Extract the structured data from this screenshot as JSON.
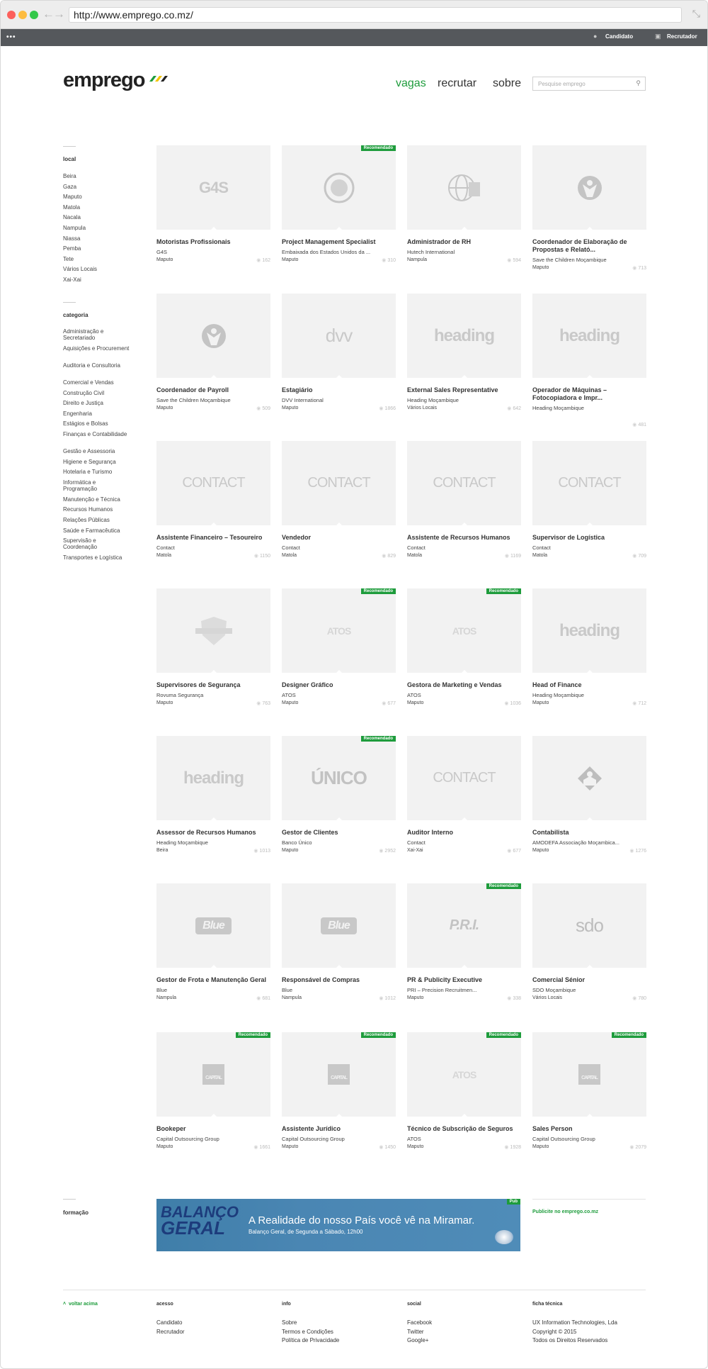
{
  "browser": {
    "url": "http://www.emprego.co.mz/"
  },
  "topbar": {
    "menu_label": "•••",
    "candidato": "Candidato",
    "recrutador": "Recrutador"
  },
  "header": {
    "logo": "emprego",
    "nav": [
      {
        "label": "vagas",
        "active": true
      },
      {
        "label": "recrutar",
        "active": false
      },
      {
        "label": "sobre",
        "active": false
      }
    ],
    "search_placeholder": "Pesquise emprego"
  },
  "sidebar": {
    "local_title": "local",
    "locations": [
      "Beira",
      "Gaza",
      "Maputo",
      "Matola",
      "Nacala",
      "Nampula",
      "Niassa",
      "Pemba",
      "Tete",
      "Vários Locais",
      "Xai-Xai"
    ],
    "category_title": "categoria",
    "categories": [
      "Administração e Secretariado",
      "Aquisições e Procurement",
      "Auditoria e Consultoria",
      "Comercial e Vendas",
      "Construção Civil",
      "Direito e Justiça",
      "Engenharia",
      "Estágios e Bolsas",
      "Finanças e Contabilidade",
      "Gestão e Assessoria",
      "Higiene e Segurança",
      "Hotelaria e Turismo",
      "Informática e Programação",
      "Manutenção e Técnica",
      "Recursos Humanos",
      "Relações Públicas",
      "Saúde e Farmacêutica",
      "Supervisão e Coordenação",
      "Transportes e Logística"
    ],
    "formacao_title": "formação"
  },
  "recommended_label": "Recomendado",
  "jobs": [
    {
      "title": "Motoristas Profissionais",
      "company": "G4S",
      "location": "Maputo",
      "views": "162",
      "logo": "G4S",
      "recommended": false
    },
    {
      "title": "Project Management Specialist",
      "company": "Embaixada dos Estados Unidos da ...",
      "location": "Maputo",
      "views": "310",
      "logo": "seal-icon",
      "recommended": true
    },
    {
      "title": "Administrador de RH",
      "company": "Hutech International",
      "location": "Nampula",
      "views": "594",
      "logo": "globe-icon",
      "recommended": false
    },
    {
      "title": "Coordenador de Elaboração de Propostas e Relató...",
      "company": "Save the Children Moçambique",
      "location": "Maputo",
      "views": "713",
      "logo": "child-icon",
      "recommended": false
    },
    {
      "title": "Coordenador de Payroll",
      "company": "Save the Children Moçambique",
      "location": "Maputo",
      "views": "509",
      "logo": "child-icon",
      "recommended": false
    },
    {
      "title": "Estagiário",
      "company": "DVV International",
      "location": "Maputo",
      "views": "1866",
      "logo": "dvv",
      "recommended": false
    },
    {
      "title": "External Sales Representative",
      "company": "Heading Moçambique",
      "location": "Vários Locais",
      "views": "642",
      "logo": "heading",
      "recommended": false
    },
    {
      "title": "Operador de Máquinas – Fotocopiadora e Impr...",
      "company": "Heading Moçambique",
      "location": "",
      "views": "481",
      "logo": "heading",
      "recommended": false
    },
    {
      "title": "Assistente Financeiro – Tesoureiro",
      "company": "Contact",
      "location": "Matola",
      "views": "1150",
      "logo": "CONTACT",
      "recommended": false
    },
    {
      "title": "Vendedor",
      "company": "Contact",
      "location": "Matola",
      "views": "829",
      "logo": "CONTACT",
      "recommended": false
    },
    {
      "title": "Assistente de Recursos Humanos",
      "company": "Contact",
      "location": "Matola",
      "views": "1169",
      "logo": "CONTACT",
      "recommended": false
    },
    {
      "title": "Supervisor de Logística",
      "company": "Contact",
      "location": "Matola",
      "views": "709",
      "logo": "CONTACT",
      "recommended": false
    },
    {
      "title": "Supervisores de Segurança",
      "company": "Rovuma Segurança",
      "location": "Maputo",
      "views": "763",
      "logo": "shield-icon",
      "recommended": false
    },
    {
      "title": "Designer Gráfico",
      "company": "ATOS",
      "location": "Maputo",
      "views": "677",
      "logo": "ATOS",
      "recommended": true
    },
    {
      "title": "Gestora de Marketing e Vendas",
      "company": "ATOS",
      "location": "Maputo",
      "views": "1036",
      "logo": "ATOS",
      "recommended": true
    },
    {
      "title": "Head of Finance",
      "company": "Heading Moçambique",
      "location": "Maputo",
      "views": "712",
      "logo": "heading",
      "recommended": false
    },
    {
      "title": "Assessor de Recursos Humanos",
      "company": "Heading Moçambique",
      "location": "Beira",
      "views": "1013",
      "logo": "heading",
      "recommended": false
    },
    {
      "title": "Gestor de Clientes",
      "company": "Banco Único",
      "location": "Maputo",
      "views": "2952",
      "logo": "ÚNICO",
      "recommended": true
    },
    {
      "title": "Auditor Interno",
      "company": "Contact",
      "location": "Xai-Xai",
      "views": "677",
      "logo": "CONTACT",
      "recommended": false
    },
    {
      "title": "Contabilista",
      "company": "AMODEFA Associação Moçambica...",
      "location": "Maputo",
      "views": "1276",
      "logo": "house-icon",
      "recommended": false
    },
    {
      "title": "Gestor de Frota e Manutenção Geral",
      "company": "Blue",
      "location": "Nampula",
      "views": "681",
      "logo": "Blue",
      "recommended": false
    },
    {
      "title": "Responsável de Compras",
      "company": "Blue",
      "location": "Nampula",
      "views": "1012",
      "logo": "Blue",
      "recommended": false
    },
    {
      "title": "PR & Publicity Executive",
      "company": "PRI – Precision Recruitmen...",
      "location": "Maputo",
      "views": "338",
      "logo": "P.R.I.",
      "recommended": true
    },
    {
      "title": "Comercial Sénior",
      "company": "SDO Moçambique",
      "location": "Vários Locais",
      "views": "780",
      "logo": "sdo",
      "recommended": false
    },
    {
      "title": "Bookeper",
      "company": "Capital Outsourcing Group",
      "location": "Maputo",
      "views": "1661",
      "logo": "CAPITAL",
      "recommended": true
    },
    {
      "title": "Assistente Jurídico",
      "company": "Capital Outsourcing Group",
      "location": "Maputo",
      "views": "1450",
      "logo": "CAPITAL",
      "recommended": true
    },
    {
      "title": "Técnico de Subscrição de Seguros",
      "company": "ATOS",
      "location": "Maputo",
      "views": "1928",
      "logo": "ATOS",
      "recommended": true
    },
    {
      "title": "Sales Person",
      "company": "Capital Outsourcing Group",
      "location": "Maputo",
      "views": "2079",
      "logo": "CAPITAL",
      "recommended": true
    }
  ],
  "banner": {
    "brand_line1": "BALANÇO",
    "brand_line2": "GERAL",
    "title": "A Realidade do nosso País você vê na Miramar.",
    "subtitle": "Balanço Geral, de Segunda a Sábado, 12h00",
    "pub_label": "Pub",
    "cta": "Publicite no emprego.co.mz"
  },
  "footer": {
    "back_top": "voltar acima",
    "columns": [
      {
        "title": "acesso",
        "links": [
          "Candidato",
          "Recrutador"
        ]
      },
      {
        "title": "info",
        "links": [
          "Sobre",
          "Termos e Condições",
          "Política de Privacidade"
        ]
      },
      {
        "title": "social",
        "links": [
          "Facebook",
          "Twitter",
          "Google+"
        ]
      },
      {
        "title": "ficha técnica",
        "links": [
          "UX Information Technologies, Lda",
          "Copyright © 2015",
          "Todos os Direitos Reservados"
        ]
      }
    ]
  },
  "colors": {
    "accent": "#1e9c3c",
    "topbar": "#55585c",
    "card_bg": "#f2f2f2"
  }
}
